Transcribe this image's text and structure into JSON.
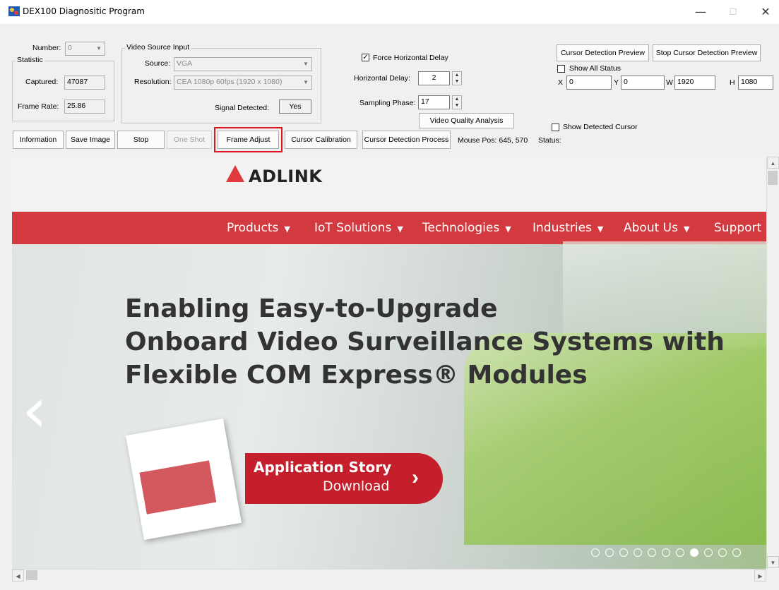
{
  "window": {
    "title": "DEX100 Diagnositic Program",
    "minimize": "—",
    "maximize": "☐",
    "close": "✕"
  },
  "number": {
    "label": "Number:",
    "value": "0"
  },
  "statistic": {
    "title": "Statistic",
    "captured_label": "Captured:",
    "captured_value": "47087",
    "framerate_label": "Frame Rate:",
    "framerate_value": "25.86"
  },
  "video_source": {
    "title": "Video Source Input",
    "source_label": "Source:",
    "source_value": "VGA",
    "resolution_label": "Resolution:",
    "resolution_value": "CEA 1080p 60fps (1920 x 1080)",
    "signal_label": "Signal Detected:",
    "signal_value": "Yes"
  },
  "timing": {
    "force_horizontal_delay_label": "Force Horizontal Delay",
    "horizontal_delay_label": "Horizontal Delay:",
    "horizontal_delay_value": "2",
    "sampling_phase_label": "Sampling Phase:",
    "sampling_phase_value": "17",
    "video_quality_button": "Video Quality Analysis"
  },
  "cursor": {
    "preview_button": "Cursor Detection Preview",
    "stop_preview_button": "Stop Cursor Detection Preview",
    "show_all_status_label": "Show All Status",
    "x_label": "X",
    "x_value": "0",
    "y_label": "Y",
    "y_value": "0",
    "w_label": "W",
    "w_value": "1920",
    "h_label": "H",
    "h_value": "1080",
    "show_detected_label": "Show Detected Cursor"
  },
  "toolbar": {
    "information": "Information",
    "save_image": "Save Image",
    "stop": "Stop",
    "one_shot": "One Shot",
    "frame_adjust": "Frame Adjust",
    "cursor_calibration": "Cursor Calibration",
    "cursor_detection_process": "Cursor Detection Process",
    "mouse_pos": "Mouse Pos: 645, 570",
    "status_label": "Status:"
  },
  "captured_frame": {
    "logo_text": "ADLINK",
    "nav": [
      "Products",
      "IoT Solutions",
      "Technologies",
      "Industries",
      "About Us",
      "Support"
    ],
    "headline_1": "Enabling Easy-to-Upgrade",
    "headline_2": "Onboard Video Surveillance Systems with",
    "headline_3": "Flexible COM Express® Modules",
    "cta_line1": "Application Story",
    "cta_line2": "Download",
    "slide_count": 11,
    "active_slide": 7
  },
  "colors": {
    "brand_red": "#d23a3f",
    "highlight_red": "#e0141e"
  }
}
